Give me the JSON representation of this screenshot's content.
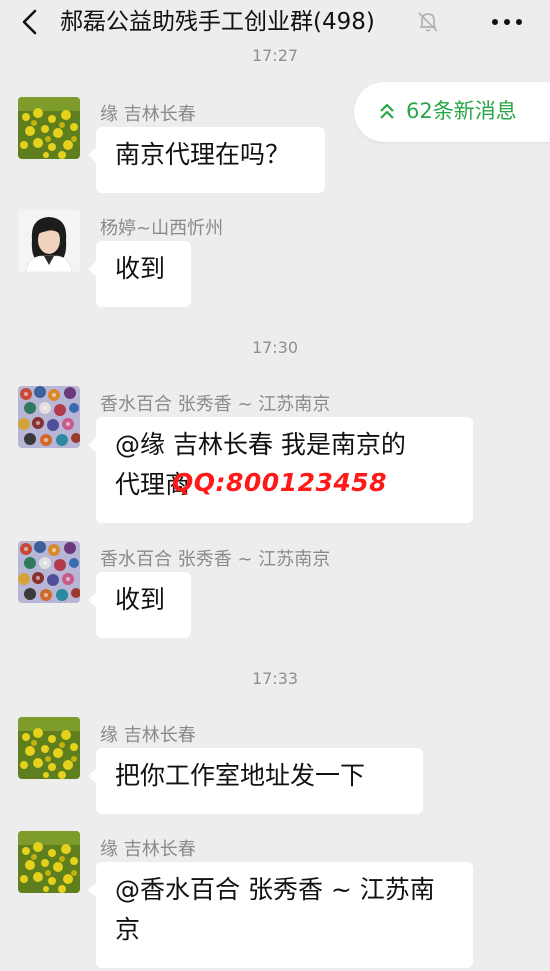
{
  "header": {
    "title": "郝磊公益助残手工创业群(498)",
    "back_icon": "chevron-left-icon",
    "mute_icon": "bell-off-icon",
    "more_icon": "more-dots-icon"
  },
  "timestamps": {
    "top_partial": "17:27",
    "t2": "17:30",
    "t3": "17:33"
  },
  "new_messages_pill": {
    "label": "62条新消息",
    "icon": "double-chevron-up-icon",
    "color": "#2aa64a"
  },
  "messages": [
    {
      "sender": "缘  吉林长春",
      "text": "南京代理在吗？",
      "avatar": "rapeseed-flowers-avatar"
    },
    {
      "sender": "杨婷~山西忻州",
      "text": "收到",
      "avatar": "woman-portrait-avatar"
    },
    {
      "sender": "香水百合 张秀香 ~ 江苏南京",
      "text_line1": "@缘  吉林长春  我是南京的",
      "text_line2": "代理商",
      "avatar": "beaded-crafts-avatar"
    },
    {
      "sender": "香水百合 张秀香 ~ 江苏南京",
      "text": "收到",
      "avatar": "beaded-crafts-avatar"
    },
    {
      "sender": "缘  吉林长春",
      "text": "把你工作室地址发一下",
      "avatar": "rapeseed-flowers-avatar"
    },
    {
      "sender": "缘  吉林长春",
      "text_line1": "@香水百合 张秀香 ~ 江苏南",
      "text_line2": "京",
      "avatar": "rapeseed-flowers-avatar"
    }
  ],
  "watermark": {
    "text": "QQ:800123458",
    "color": "#ff1a1a"
  }
}
